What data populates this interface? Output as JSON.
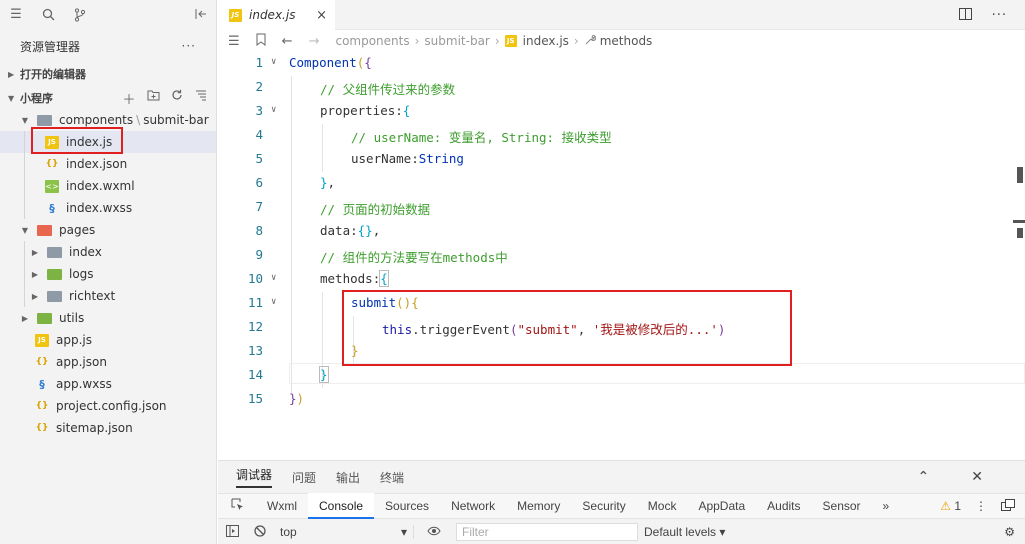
{
  "colors": {
    "accent": "#1a73e8",
    "highlight_box": "#e02020",
    "selected_row": "#e4e6f1"
  },
  "sidebar": {
    "toolbar_icons": [
      "list-icon",
      "search-icon",
      "source-control-icon",
      "collapse-panel-icon"
    ],
    "title": "资源管理器",
    "more": "···",
    "open_editors": "打开的编辑器",
    "project": "小程序",
    "tree": [
      {
        "label": "components",
        "suffix": "submit-bar",
        "sep": "\\",
        "type": "folder-gray",
        "expanded": true,
        "level": 1
      },
      {
        "label": "index.js",
        "type": "js",
        "level": 2,
        "selected": true
      },
      {
        "label": "index.json",
        "type": "json",
        "level": 2
      },
      {
        "label": "index.wxml",
        "type": "wxml",
        "level": 2
      },
      {
        "label": "index.wxss",
        "type": "wxss",
        "level": 2
      },
      {
        "label": "pages",
        "type": "folder-red",
        "expanded": true,
        "level": 1
      },
      {
        "label": "index",
        "type": "folder-gray",
        "level": 2
      },
      {
        "label": "logs",
        "type": "folder-green",
        "level": 2
      },
      {
        "label": "richtext",
        "type": "folder-gray",
        "level": 2
      },
      {
        "label": "utils",
        "type": "folder-green",
        "level": 1
      },
      {
        "label": "app.js",
        "type": "js",
        "level": 1
      },
      {
        "label": "app.json",
        "type": "json",
        "level": 1
      },
      {
        "label": "app.wxss",
        "type": "wxss",
        "level": 1
      },
      {
        "label": "project.config.json",
        "type": "json",
        "level": 1
      },
      {
        "label": "sitemap.json",
        "type": "json",
        "level": 1
      }
    ]
  },
  "editor": {
    "tab": {
      "label": "index.js",
      "close": "×"
    },
    "breadcrumb": [
      "components",
      "submit-bar",
      "index.js",
      "methods"
    ],
    "lines": [
      {
        "n": "1",
        "fold": true
      },
      {
        "n": "2"
      },
      {
        "n": "3",
        "fold": true
      },
      {
        "n": "4"
      },
      {
        "n": "5"
      },
      {
        "n": "6"
      },
      {
        "n": "7"
      },
      {
        "n": "8"
      },
      {
        "n": "9"
      },
      {
        "n": "10",
        "fold": true
      },
      {
        "n": "11",
        "fold": true
      },
      {
        "n": "12"
      },
      {
        "n": "13"
      },
      {
        "n": "14"
      },
      {
        "n": "15"
      }
    ],
    "code": {
      "l1": [
        "Component",
        "(",
        "{"
      ],
      "l2": "// 父组件传过来的参数",
      "l3": [
        "properties",
        ":",
        "{"
      ],
      "l4": "// userName: 变量名, String: 接收类型",
      "l5": [
        "userName",
        ":",
        "String"
      ],
      "l6": [
        "}",
        ","
      ],
      "l7": "// 页面的初始数据",
      "l8": [
        "data",
        ":",
        "{}",
        ","
      ],
      "l9": "// 组件的方法要写在methods中",
      "l10": [
        "methods",
        ":",
        "{"
      ],
      "l11": [
        "submit",
        "()",
        "{"
      ],
      "l12": [
        "this",
        ".",
        "triggerEvent",
        "(",
        "\"submit\"",
        ", ",
        "'我是被修改后的...'",
        ")"
      ],
      "l13": "}",
      "l14": "}",
      "l15": [
        "}",
        ")"
      ]
    }
  },
  "panel": {
    "tabs": [
      "调试器",
      "问题",
      "输出",
      "终端"
    ],
    "devtools_tabs": [
      "Wxml",
      "Console",
      "Sources",
      "Network",
      "Memory",
      "Security",
      "Mock",
      "AppData",
      "Audits",
      "Sensor"
    ],
    "active_devtools_tab": "Console",
    "more": "»",
    "warnings": "1",
    "context": "top",
    "filter_placeholder": "Filter",
    "levels": "Default levels ▾"
  }
}
